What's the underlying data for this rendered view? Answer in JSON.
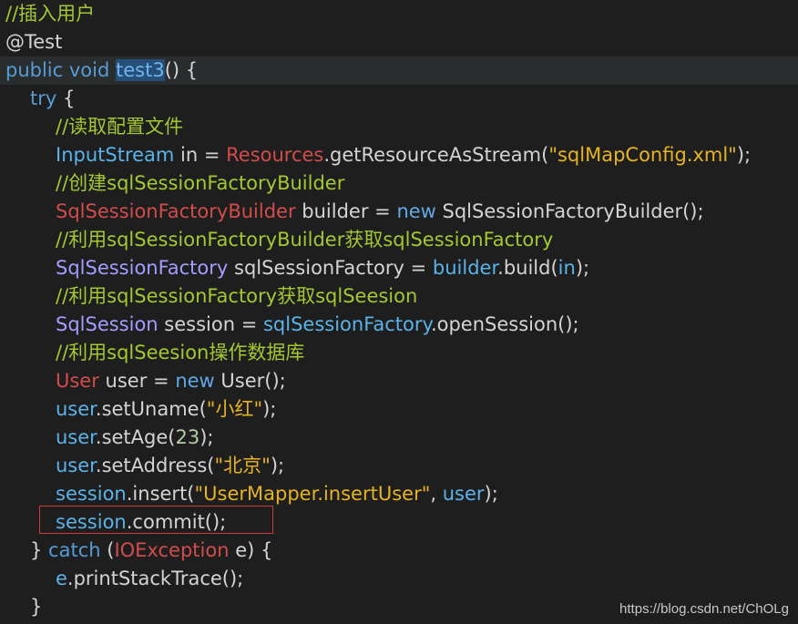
{
  "code_lines": [
    {
      "indent": 0,
      "highlight": false,
      "tokens": [
        {
          "t": "//插入用户",
          "c": "comment"
        }
      ]
    },
    {
      "indent": 0,
      "highlight": false,
      "tokens": [
        {
          "t": "@Test",
          "c": "annot"
        }
      ]
    },
    {
      "indent": 0,
      "highlight": true,
      "tokens": [
        {
          "t": "public void ",
          "c": "keyword"
        },
        {
          "t": "test3",
          "c": "selected"
        },
        {
          "t": "() {",
          "c": "plain"
        }
      ]
    },
    {
      "indent": 1,
      "highlight": false,
      "tokens": [
        {
          "t": "try",
          "c": "keyword"
        },
        {
          "t": " {",
          "c": "plain"
        }
      ]
    },
    {
      "indent": 2,
      "highlight": false,
      "tokens": [
        {
          "t": "//读取配置文件",
          "c": "comment"
        }
      ]
    },
    {
      "indent": 2,
      "highlight": false,
      "tokens": [
        {
          "t": "InputStream",
          "c": "var"
        },
        {
          "t": " in = ",
          "c": "plain"
        },
        {
          "t": "Resources",
          "c": "type"
        },
        {
          "t": ".getResourceAsStream(",
          "c": "plain"
        },
        {
          "t": "\"sqlMapConfig.xml\"",
          "c": "string"
        },
        {
          "t": ");",
          "c": "plain"
        }
      ]
    },
    {
      "indent": 2,
      "highlight": false,
      "tokens": [
        {
          "t": "//创建sqlSessionFactoryBuilder",
          "c": "comment"
        }
      ]
    },
    {
      "indent": 2,
      "highlight": false,
      "tokens": [
        {
          "t": "SqlSessionFactoryBuilder",
          "c": "type"
        },
        {
          "t": " builder = ",
          "c": "plain"
        },
        {
          "t": "new",
          "c": "keyword2"
        },
        {
          "t": " SqlSessionFactoryBuilder();",
          "c": "plain"
        }
      ]
    },
    {
      "indent": 2,
      "highlight": false,
      "tokens": [
        {
          "t": "//利用sqlSessionFactoryBuilder获取sqlSessionFactory",
          "c": "comment"
        }
      ]
    },
    {
      "indent": 2,
      "highlight": false,
      "tokens": [
        {
          "t": "SqlSessionFactory",
          "c": "type2"
        },
        {
          "t": " sqlSessionFactory = ",
          "c": "plain"
        },
        {
          "t": "builder",
          "c": "var"
        },
        {
          "t": ".build(",
          "c": "plain"
        },
        {
          "t": "in",
          "c": "var"
        },
        {
          "t": ");",
          "c": "plain"
        }
      ]
    },
    {
      "indent": 2,
      "highlight": false,
      "tokens": [
        {
          "t": "//利用sqlSessionFactory获取sqlSeesion",
          "c": "comment"
        }
      ]
    },
    {
      "indent": 2,
      "highlight": false,
      "tokens": [
        {
          "t": "SqlSession",
          "c": "type2"
        },
        {
          "t": " session = ",
          "c": "plain"
        },
        {
          "t": "sqlSessionFactory",
          "c": "var"
        },
        {
          "t": ".openSession();",
          "c": "plain"
        }
      ]
    },
    {
      "indent": 2,
      "highlight": false,
      "tokens": [
        {
          "t": "//利用sqlSeesion操作数据库",
          "c": "comment"
        }
      ]
    },
    {
      "indent": 2,
      "highlight": false,
      "tokens": [
        {
          "t": "User",
          "c": "type"
        },
        {
          "t": " user = ",
          "c": "plain"
        },
        {
          "t": "new",
          "c": "keyword2"
        },
        {
          "t": " User();",
          "c": "plain"
        }
      ]
    },
    {
      "indent": 2,
      "highlight": false,
      "tokens": [
        {
          "t": "user",
          "c": "var"
        },
        {
          "t": ".setUname(",
          "c": "plain"
        },
        {
          "t": "\"小红\"",
          "c": "string"
        },
        {
          "t": ");",
          "c": "plain"
        }
      ]
    },
    {
      "indent": 2,
      "highlight": false,
      "tokens": [
        {
          "t": "user",
          "c": "var"
        },
        {
          "t": ".setAge(",
          "c": "plain"
        },
        {
          "t": "23",
          "c": "number"
        },
        {
          "t": ");",
          "c": "plain"
        }
      ]
    },
    {
      "indent": 2,
      "highlight": false,
      "tokens": [
        {
          "t": "user",
          "c": "var"
        },
        {
          "t": ".setAddress(",
          "c": "plain"
        },
        {
          "t": "\"北京\"",
          "c": "string"
        },
        {
          "t": ");",
          "c": "plain"
        }
      ]
    },
    {
      "indent": 2,
      "highlight": false,
      "tokens": [
        {
          "t": "session",
          "c": "var"
        },
        {
          "t": ".insert(",
          "c": "plain"
        },
        {
          "t": "\"UserMapper.insertUser\"",
          "c": "string"
        },
        {
          "t": ", ",
          "c": "plain"
        },
        {
          "t": "user",
          "c": "var"
        },
        {
          "t": ");",
          "c": "plain"
        }
      ]
    },
    {
      "indent": 2,
      "highlight": false,
      "tokens": [
        {
          "t": "session",
          "c": "var"
        },
        {
          "t": ".commit();",
          "c": "plain"
        }
      ]
    },
    {
      "indent": 1,
      "highlight": false,
      "tokens": [
        {
          "t": "} ",
          "c": "plain"
        },
        {
          "t": "catch",
          "c": "keyword"
        },
        {
          "t": " (",
          "c": "plain"
        },
        {
          "t": "IOException",
          "c": "type"
        },
        {
          "t": " e) {",
          "c": "plain"
        }
      ]
    },
    {
      "indent": 2,
      "highlight": false,
      "tokens": [
        {
          "t": "e",
          "c": "var"
        },
        {
          "t": ".printStackTrace();",
          "c": "plain"
        }
      ]
    },
    {
      "indent": 1,
      "highlight": false,
      "tokens": [
        {
          "t": "}",
          "c": "plain"
        }
      ]
    }
  ],
  "watermark": "https://blog.csdn.net/ChOLg",
  "colors": {
    "background": "#1e1e1e",
    "comment": "#a3c832",
    "keyword": "#569cd6",
    "type": "#d24c4c",
    "type2": "#a49dff",
    "variable": "#5ab3ea",
    "string": "#e6b422",
    "highlight_box": "#d13a3a"
  }
}
